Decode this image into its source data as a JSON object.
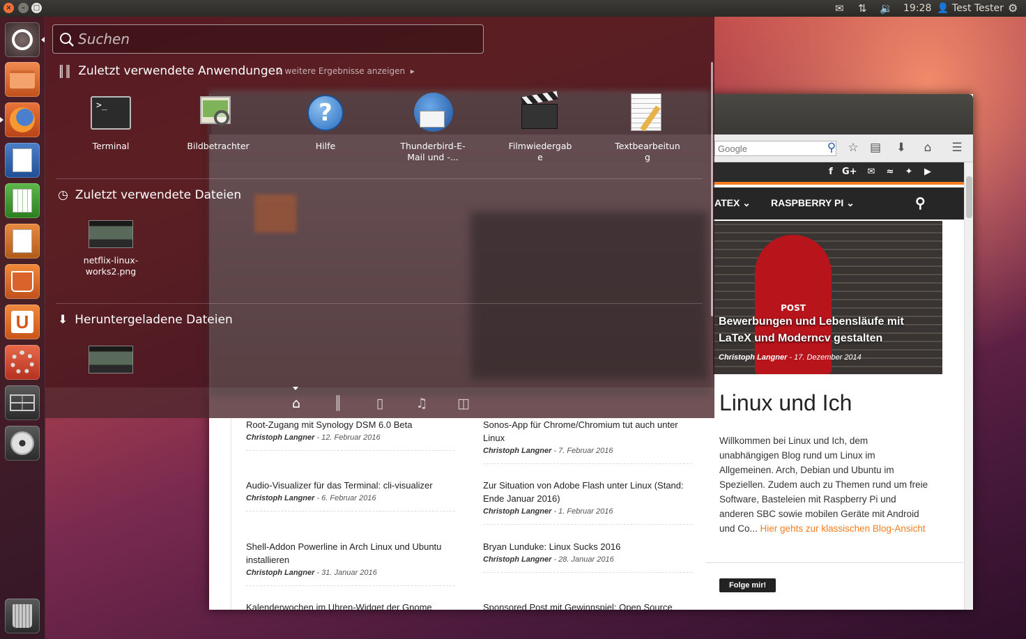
{
  "panel": {
    "clock": "19:28",
    "user": "Test Tester"
  },
  "launcher": {
    "items": [
      {
        "name": "dash-home",
        "icon": "ubuntu-logo-icon"
      },
      {
        "name": "files",
        "icon": "folder-icon"
      },
      {
        "name": "firefox",
        "icon": "firefox-icon"
      },
      {
        "name": "libreoffice-writer",
        "icon": "writer-icon"
      },
      {
        "name": "libreoffice-calc",
        "icon": "calc-icon"
      },
      {
        "name": "libreoffice-impress",
        "icon": "impress-icon"
      },
      {
        "name": "software-center",
        "icon": "shopping-bag-icon"
      },
      {
        "name": "ubuntu-one",
        "icon": "ubuntu-one-icon"
      },
      {
        "name": "system-settings",
        "icon": "settings-icon"
      },
      {
        "name": "workspaces",
        "icon": "workspace-switcher-icon"
      },
      {
        "name": "dvd",
        "icon": "disc-icon"
      },
      {
        "name": "trash",
        "icon": "trash-icon"
      }
    ]
  },
  "dash": {
    "search_placeholder": "Suchen",
    "recent_apps": {
      "title": "Zuletzt verwendete Anwendungen",
      "more": "2 weitere Ergebnisse anzeigen",
      "apps": [
        {
          "label": "Terminal"
        },
        {
          "label": "Bildbetrachter"
        },
        {
          "label": "Hilfe"
        },
        {
          "label_line1": "Thunderbird-E-",
          "label_line2": "Mail und -..."
        },
        {
          "label_line1": "Filmwiedergab",
          "label_line2": "e"
        },
        {
          "label_line1": "Textbearbeitun",
          "label_line2": "g"
        }
      ]
    },
    "recent_files": {
      "title": "Zuletzt verwendete  Dateien",
      "files": [
        {
          "label_line1": "netflix-linux-",
          "label_line2": "works2.png"
        }
      ]
    },
    "downloads": {
      "title": "Heruntergeladene Dateien"
    },
    "lenses": [
      "home-icon",
      "applications-icon",
      "files-icon",
      "music-icon",
      "video-icon"
    ]
  },
  "browser": {
    "search_placeholder": "Google",
    "nav": {
      "item1": "ATEX",
      "item2": "RASPBERRY PI"
    },
    "hero": {
      "title_line1": "Bewerbungen und Lebensläufe mit",
      "title_line2": "LaTeX und Moderncv gestalten",
      "author": "Christoph Langner",
      "date": "17. Dezember 2014",
      "postbox_text": "POST"
    },
    "sidebar": {
      "heading": "Linux und Ich",
      "text": "Willkommen bei Linux und Ich, dem unabhängigen Blog rund um Linux im Allgemeinen. Arch, Debian und Ubuntu im Speziellen. Zudem auch zu Themen rund um freie Software, Basteleien mit Raspberry Pi und anderen SBC sowie mobilen Geräte mit Android und Co... ",
      "link": "Hier gehts zur klassischen Blog-Ansicht",
      "follow": "Folge mir!"
    },
    "articles": [
      {
        "title": "Root-Zugang mit Synology DSM 6.0 Beta",
        "author": "Christoph Langner",
        "date": "12. Februar 2016"
      },
      {
        "title": "Sonos-App für Chrome/Chromium tut auch unter Linux",
        "author": "Christoph Langner",
        "date": "7. Februar 2016"
      },
      {
        "title": "Audio-Visualizer für das Terminal: cli-visualizer",
        "author": "Christoph Langner",
        "date": "6. Februar 2016"
      },
      {
        "title": "Zur Situation von Adobe Flash unter Linux (Stand: Ende Januar 2016)",
        "author": "Christoph Langner",
        "date": "1. Februar 2016"
      },
      {
        "title": "Shell-Addon Powerline in Arch Linux und Ubuntu installieren",
        "author": "Christoph Langner",
        "date": "31. Januar 2016"
      },
      {
        "title": "Bryan Lunduke: Linux Sucks 2016",
        "author": "Christoph Langner",
        "date": "28. Januar 2016"
      },
      {
        "title": "Kalenderwochen im Uhren-Widget der Gnome",
        "author": "",
        "date": ""
      },
      {
        "title": "Sponsored Post mit Gewinnspiel: Open Source",
        "author": "",
        "date": ""
      }
    ]
  }
}
